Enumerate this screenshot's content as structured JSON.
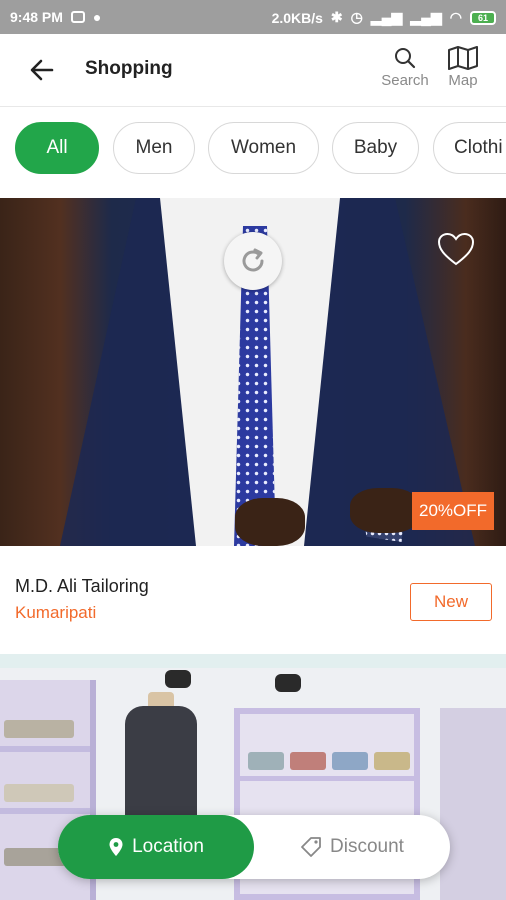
{
  "status_bar": {
    "time": "9:48 PM",
    "network_speed": "2.0KB/s",
    "battery": "61"
  },
  "app_bar": {
    "title": "Shopping",
    "search_label": "Search",
    "map_label": "Map"
  },
  "categories": [
    {
      "label": "All",
      "active": true
    },
    {
      "label": "Men",
      "active": false
    },
    {
      "label": "Women",
      "active": false
    },
    {
      "label": "Baby",
      "active": false
    },
    {
      "label": "Clothi",
      "active": false
    }
  ],
  "listings": [
    {
      "name": "M.D. Ali Tailoring",
      "location": "Kumaripati",
      "discount_badge": "20%OFF",
      "tag": "New"
    }
  ],
  "bottom_toggle": {
    "location_label": "Location",
    "discount_label": "Discount"
  },
  "colors": {
    "accent_green": "#22a64a",
    "accent_orange": "#f26a2b"
  }
}
